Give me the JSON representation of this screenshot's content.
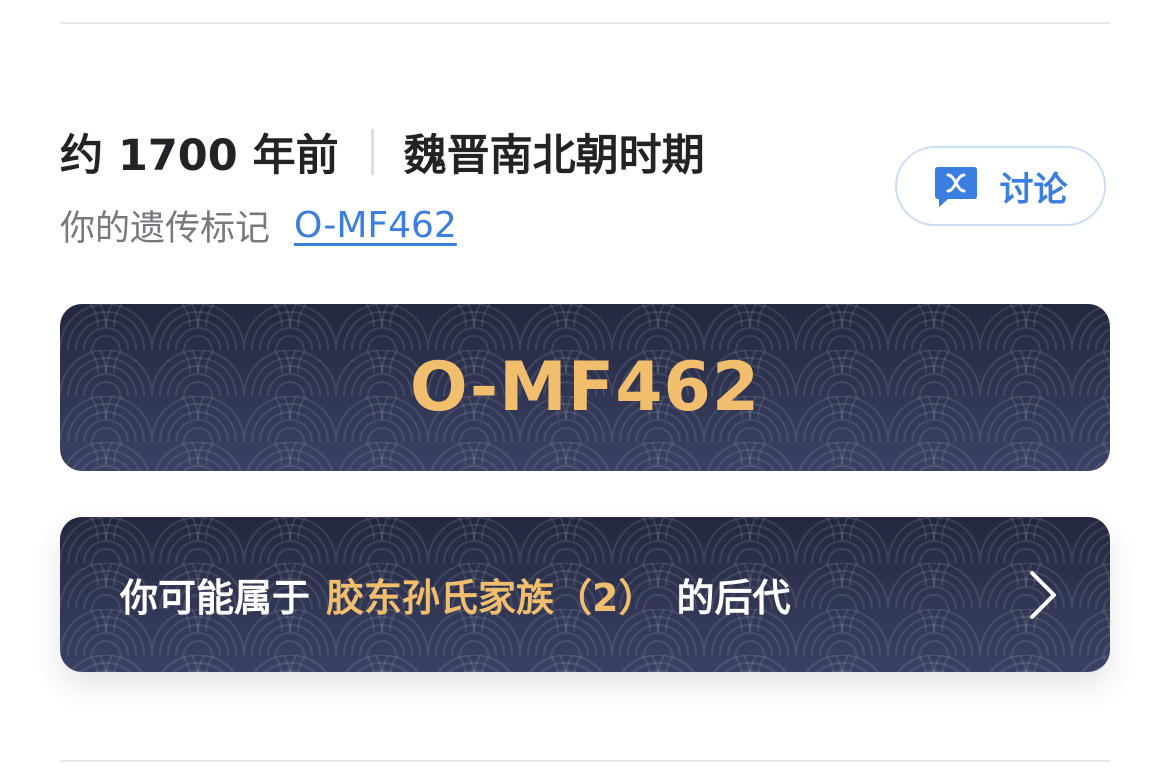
{
  "era": {
    "years_ago": "约 1700 年前",
    "period": "魏晋南北朝时期"
  },
  "marker": {
    "label": "你的遗传标记",
    "value": "O-MF462"
  },
  "discuss_button": {
    "label": "讨论",
    "icon": "chat-bubble-icon"
  },
  "haplogroup_card": {
    "title": "O-MF462"
  },
  "clan_card": {
    "prefix": "你可能属于",
    "clan_name": "胶东孙氏家族（2）",
    "suffix": "的后代",
    "icon": "chevron-right-icon"
  },
  "colors": {
    "accent_blue": "#3a7ee0",
    "gold": "#f1be6e",
    "card_dark": "#23283f",
    "card_light": "#3a4163"
  }
}
